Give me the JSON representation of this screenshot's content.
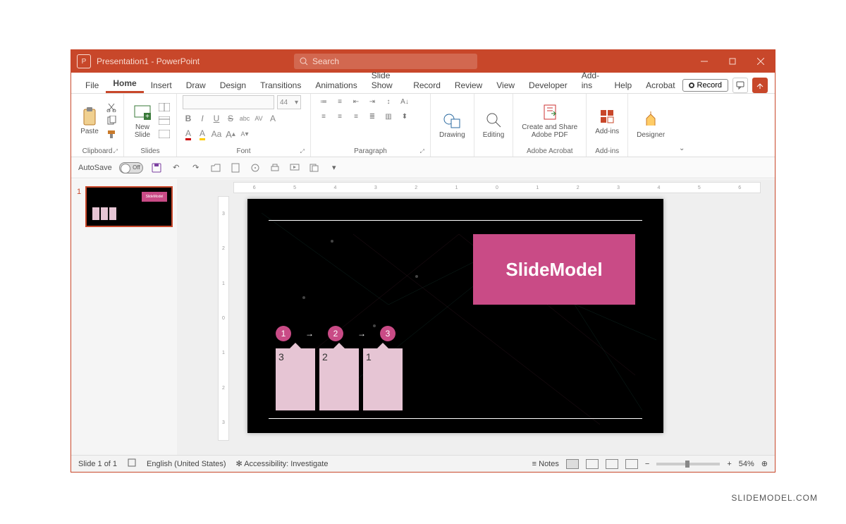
{
  "title": "Presentation1 - PowerPoint",
  "search_placeholder": "Search",
  "tabs": [
    "File",
    "Home",
    "Insert",
    "Draw",
    "Design",
    "Transitions",
    "Animations",
    "Slide Show",
    "Record",
    "Review",
    "View",
    "Developer",
    "Add-ins",
    "Help",
    "Acrobat"
  ],
  "active_tab": "Home",
  "record_btn": "Record",
  "ribbon": {
    "clipboard": {
      "paste": "Paste",
      "label": "Clipboard"
    },
    "slides": {
      "new_slide": "New\nSlide",
      "label": "Slides"
    },
    "font": {
      "size": "44",
      "label": "Font",
      "bold": "B",
      "italic": "I",
      "underline": "U",
      "strike": "S",
      "shadow": "abc",
      "spacing": "AV",
      "clear": "A",
      "case": "Aa",
      "grow": "A",
      "shrink": "A"
    },
    "paragraph": {
      "label": "Paragraph"
    },
    "drawing": {
      "btn": "Drawing",
      "label": ""
    },
    "editing": {
      "btn": "Editing",
      "label": ""
    },
    "adobe": {
      "btn": "Create and Share\nAdobe PDF",
      "label": "Adobe Acrobat"
    },
    "addins": {
      "btn": "Add-ins",
      "label": "Add-ins"
    },
    "designer": {
      "btn": "Designer",
      "label": ""
    }
  },
  "qat": {
    "autosave": "AutoSave",
    "off": "Off"
  },
  "thumb_index": "1",
  "slide": {
    "title": "SlideModel",
    "steps": [
      "1",
      "2",
      "3"
    ],
    "cards": [
      "3",
      "2",
      "1"
    ]
  },
  "ruler_h": [
    "6",
    "5",
    "4",
    "3",
    "2",
    "1",
    "0",
    "1",
    "2",
    "3",
    "4",
    "5",
    "6"
  ],
  "ruler_v": [
    "3",
    "2",
    "1",
    "0",
    "1",
    "2",
    "3"
  ],
  "status": {
    "slide": "Slide 1 of 1",
    "lang": "English (United States)",
    "access": "Accessibility: Investigate",
    "notes": "Notes",
    "zoom": "54%"
  },
  "watermark": "SLIDEMODEL.COM"
}
